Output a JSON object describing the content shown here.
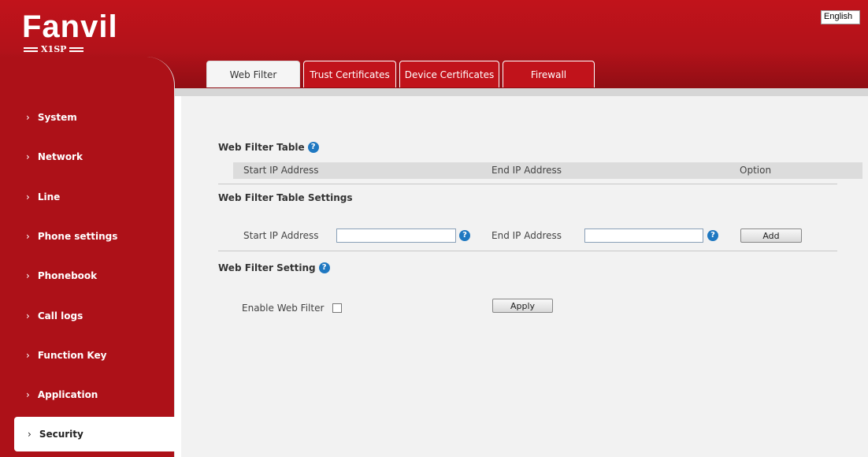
{
  "brand": {
    "name": "Fanvil",
    "model": "X1SP"
  },
  "language": {
    "selected": "English"
  },
  "tabs": [
    {
      "label": "Web Filter"
    },
    {
      "label": "Trust Certificates"
    },
    {
      "label": "Device Certificates"
    },
    {
      "label": "Firewall"
    }
  ],
  "sidebar": {
    "items": [
      {
        "label": "System"
      },
      {
        "label": "Network"
      },
      {
        "label": "Line"
      },
      {
        "label": "Phone settings"
      },
      {
        "label": "Phonebook"
      },
      {
        "label": "Call logs"
      },
      {
        "label": "Function Key"
      },
      {
        "label": "Application"
      },
      {
        "label": "Security"
      }
    ]
  },
  "web_filter_table": {
    "title": "Web Filter Table",
    "columns": [
      "Start IP Address",
      "End IP Address",
      "Option"
    ]
  },
  "web_filter_table_settings": {
    "title": "Web Filter Table Settings",
    "start_label": "Start IP Address",
    "start_value": "",
    "end_label": "End IP Address",
    "end_value": "",
    "add_label": "Add"
  },
  "web_filter_setting": {
    "title": "Web Filter Setting",
    "enable_label": "Enable Web Filter",
    "enabled": false,
    "apply_label": "Apply"
  },
  "colors": {
    "brand_red": "#c1131b",
    "help_blue": "#1f78c1"
  },
  "icons": {
    "help": "help-icon",
    "chevron": "chevron-right-icon"
  }
}
